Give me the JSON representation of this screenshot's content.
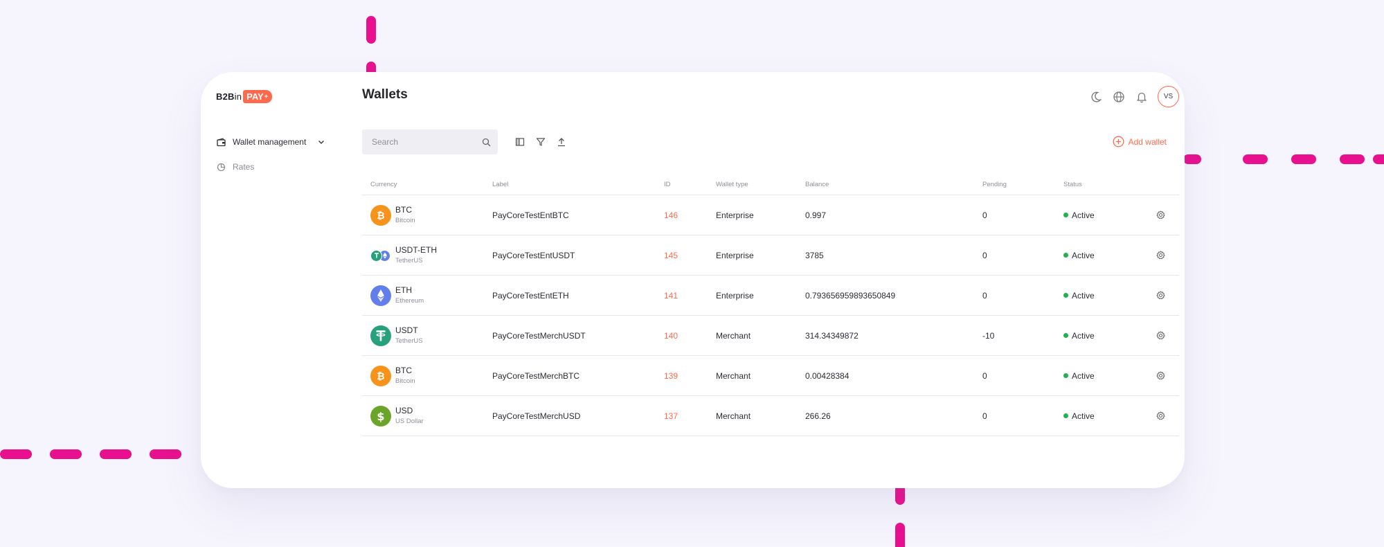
{
  "colors": {
    "accent": "#ff6a4d",
    "decor_dash": "#e8108f",
    "background": "#f6f4fd",
    "status_active": "#22b14c"
  },
  "logo": {
    "part1": "B2B",
    "part2": "in",
    "badge": "PAY",
    "badge_plus": "+"
  },
  "sidebar": {
    "items": [
      {
        "label": "Wallet management",
        "icon": "wallet-icon",
        "expanded": true
      },
      {
        "label": "Rates",
        "icon": "pie-chart-icon"
      }
    ]
  },
  "header": {
    "title": "Wallets",
    "icons": [
      "moon-icon",
      "globe-icon",
      "bell-icon"
    ],
    "avatar": "VS"
  },
  "toolbar": {
    "search_placeholder": "Search",
    "icons": [
      "columns-icon",
      "filter-icon",
      "export-icon"
    ],
    "add_wallet_label": "Add wallet"
  },
  "table": {
    "columns": [
      "Currency",
      "Label",
      "ID",
      "Wallet type",
      "Balance",
      "Pending",
      "Status"
    ],
    "rows": [
      {
        "code": "BTC",
        "name": "Bitcoin",
        "label": "PayCoreTestEntBTC",
        "id": "146",
        "type": "Enterprise",
        "balance": "0.997",
        "pending": "0",
        "status": "Active",
        "coin": "btc"
      },
      {
        "code": "USDT-ETH",
        "name": "TetherUS",
        "label": "PayCoreTestEntUSDT",
        "id": "145",
        "type": "Enterprise",
        "balance": "3785",
        "pending": "0",
        "status": "Active",
        "coin": "usdt-eth"
      },
      {
        "code": "ETH",
        "name": "Ethereum",
        "label": "PayCoreTestEntETH",
        "id": "141",
        "type": "Enterprise",
        "balance": "0.793656959893650849",
        "pending": "0",
        "status": "Active",
        "coin": "eth"
      },
      {
        "code": "USDT",
        "name": "TetherUS",
        "label": "PayCoreTestMerchUSDT",
        "id": "140",
        "type": "Merchant",
        "balance": "314.34349872",
        "pending": "-10",
        "status": "Active",
        "coin": "usdt"
      },
      {
        "code": "BTC",
        "name": "Bitcoin",
        "label": "PayCoreTestMerchBTC",
        "id": "139",
        "type": "Merchant",
        "balance": "0.00428384",
        "pending": "0",
        "status": "Active",
        "coin": "btc"
      },
      {
        "code": "USD",
        "name": "US Dollar",
        "label": "PayCoreTestMerchUSD",
        "id": "137",
        "type": "Merchant",
        "balance": "266.26",
        "pending": "0",
        "status": "Active",
        "coin": "usd"
      }
    ]
  }
}
